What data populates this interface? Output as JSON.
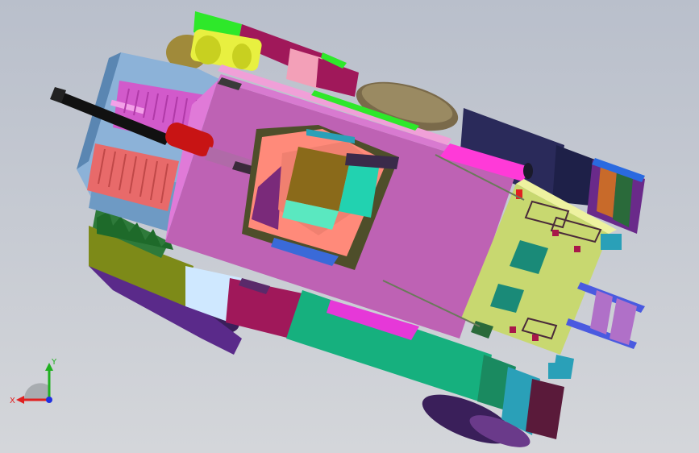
{
  "viewport": {
    "background_top": "#b9bfcb",
    "background_bottom": "#d4d6da"
  },
  "model": {
    "icons": [
      "assembly-model"
    ]
  },
  "triad": {
    "x_label": "X",
    "y_label": "Y",
    "x_color": "#e02020",
    "y_color": "#20b020",
    "z_color": "#2030e0"
  }
}
